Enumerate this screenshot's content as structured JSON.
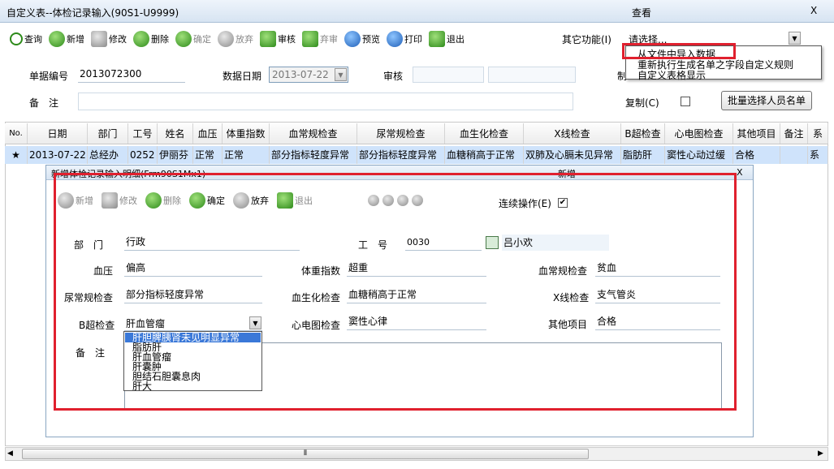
{
  "window": {
    "title": "自定义表--体检记录输入(90S1-U9999)",
    "mode": "查看",
    "close": "X"
  },
  "toolbar": [
    {
      "label": "查询",
      "icon": "search-icon"
    },
    {
      "label": "新增",
      "icon": "add-icon"
    },
    {
      "label": "修改",
      "icon": "edit-icon"
    },
    {
      "label": "删除",
      "icon": "delete-icon"
    },
    {
      "label": "确定",
      "icon": "check-icon"
    },
    {
      "label": "放弃",
      "icon": "cancel-icon"
    },
    {
      "label": "审核",
      "icon": "approve-icon"
    },
    {
      "label": "弃审",
      "icon": "unapprove-icon"
    },
    {
      "label": "预览",
      "icon": "preview-icon"
    },
    {
      "label": "打印",
      "icon": "print-icon"
    },
    {
      "label": "退出",
      "icon": "exit-icon"
    }
  ],
  "other_func": {
    "label": "其它功能(I)",
    "select_placeholder": "请选择...",
    "menu": [
      "从文件中导入数据",
      "重新执行生成名单之字段自定义规则",
      "自定义表格显示"
    ]
  },
  "form": {
    "doc_no_label": "单据编号",
    "doc_no": "2013072300",
    "date_label": "数据日期",
    "date": "2013-07-22",
    "audit_label": "审核",
    "maker_label": "制",
    "remark_label": "备　注",
    "copy_label": "复制(C)",
    "batch_btn": "批量选择人员名单"
  },
  "grid": {
    "headers": [
      "No.",
      "日期",
      "部门",
      "工号",
      "姓名",
      "血压",
      "体重指数",
      "血常规检查",
      "尿常规检查",
      "血生化检查",
      "X线检查",
      "B超检查",
      "心电图检查",
      "其他项目",
      "备注",
      "系"
    ],
    "rows": [
      [
        "★",
        "2013-07-22",
        "总经办",
        "0252",
        "伊丽芬",
        "正常",
        "正常",
        "部分指标轻度异常",
        "部分指标轻度异常",
        "血糖稍高于正常",
        "双肺及心膈未见异常",
        "脂肪肝",
        "窦性心动过缓",
        "合格",
        "",
        "系"
      ]
    ]
  },
  "dialog": {
    "title": "新增体检记录输入明细(Frm90S1Mx1)",
    "mode": "新增",
    "close": "X",
    "toolbar": [
      {
        "label": "新增"
      },
      {
        "label": "修改"
      },
      {
        "label": "删除"
      },
      {
        "label": "确定"
      },
      {
        "label": "放弃"
      },
      {
        "label": "退出"
      }
    ],
    "continuous_label": "连续操作(E)",
    "continuous_checked": "✔",
    "fields": {
      "dept_label": "部　门",
      "dept": "行政",
      "empno_label": "工　号",
      "empno": "0030",
      "name": "吕小欢",
      "bp_label": "血压",
      "bp": "偏高",
      "bmi_label": "体重指数",
      "bmi": "超重",
      "blood_label": "血常规检查",
      "blood": "贫血",
      "urine_label": "尿常规检查",
      "urine": "部分指标轻度异常",
      "biochem_label": "血生化检查",
      "biochem": "血糖稍高于正常",
      "xray_label": "X线检查",
      "xray": "支气管炎",
      "bus_label": "B超检查",
      "bus": "肝血管瘤",
      "ecg_label": "心电图检查",
      "ecg": "窦性心律",
      "other_label": "其他项目",
      "other": "合格",
      "remark_label": "备　注"
    },
    "bus_options": [
      "肝胆脾胰肾未见明显异常",
      "脂肪肝",
      "肝血管瘤",
      "肝囊肿",
      "胆结石胆囊息肉",
      "肝大"
    ]
  },
  "scroll": {
    "grip": "⦀"
  }
}
